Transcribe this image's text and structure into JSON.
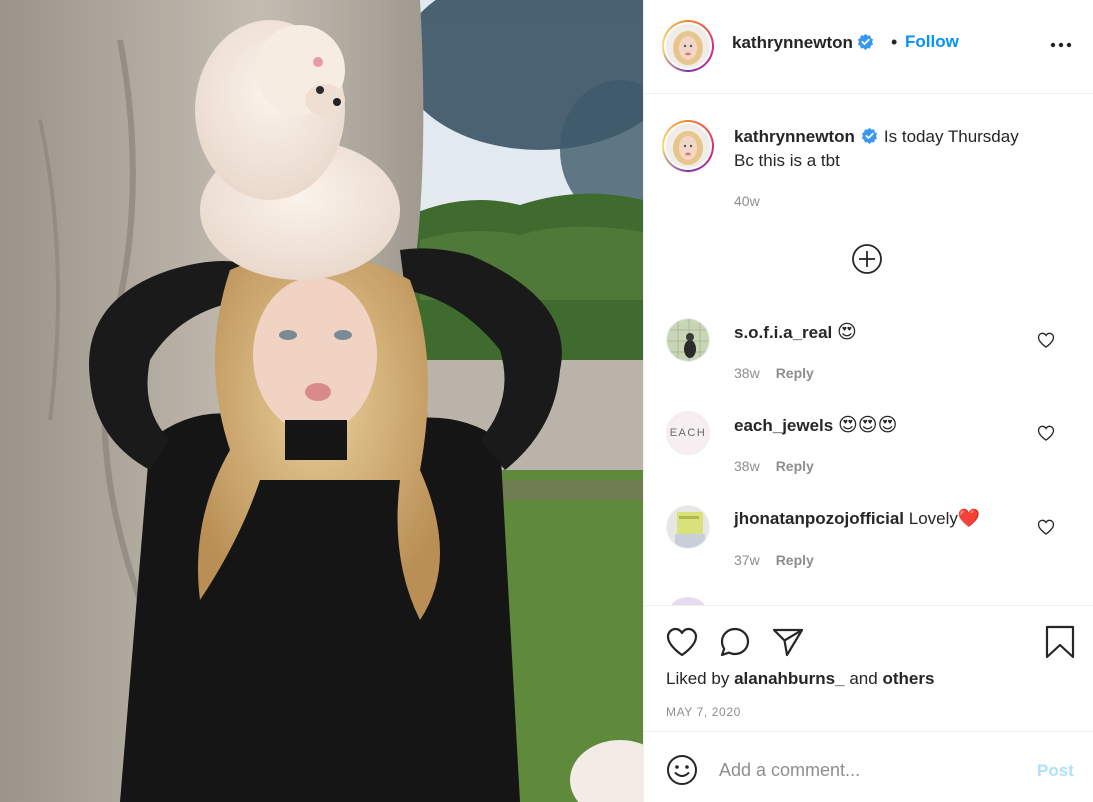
{
  "author": {
    "username": "kathrynnewton",
    "verified": true,
    "follow_label": "Follow",
    "separator": "•"
  },
  "icons": {
    "more": "more-options-icon",
    "verified": "verified-badge-icon",
    "load_more": "load-more-comments-icon",
    "like": "heart-icon",
    "comment": "comment-bubble-icon",
    "share": "paper-plane-icon",
    "save": "bookmark-icon",
    "emoji": "smiley-face-icon"
  },
  "caption": {
    "username": "kathrynnewton",
    "line1": "Is today Thursday",
    "line2": "Bc this is a tbt",
    "time": "40w"
  },
  "comments": [
    {
      "username": "s.o.f.i.a_real",
      "text": "",
      "emoji": "😍",
      "emoji_count": 1,
      "time": "38w",
      "reply_label": "Reply"
    },
    {
      "username": "each_jewels",
      "text": "",
      "emoji": "😍",
      "emoji_count": 3,
      "time": "38w",
      "reply_label": "Reply",
      "avatar_text": "EACH"
    },
    {
      "username": "jhonatanpozojofficial",
      "text": "Lovely",
      "emoji": "❤️",
      "emoji_count": 1,
      "time": "37w",
      "reply_label": "Reply"
    }
  ],
  "likes": {
    "prefix": "Liked by",
    "user": "alanahburns_",
    "connector": "and",
    "others": "others"
  },
  "date": "MAY 7, 2020",
  "add_comment": {
    "placeholder": "Add a comment...",
    "post_label": "Post"
  },
  "colors": {
    "accent": "#0095f6",
    "post_disabled": "#b2dffc",
    "muted": "#8e8e8e",
    "text": "#262626",
    "border": "#efefef",
    "verified": "#3897f0"
  }
}
